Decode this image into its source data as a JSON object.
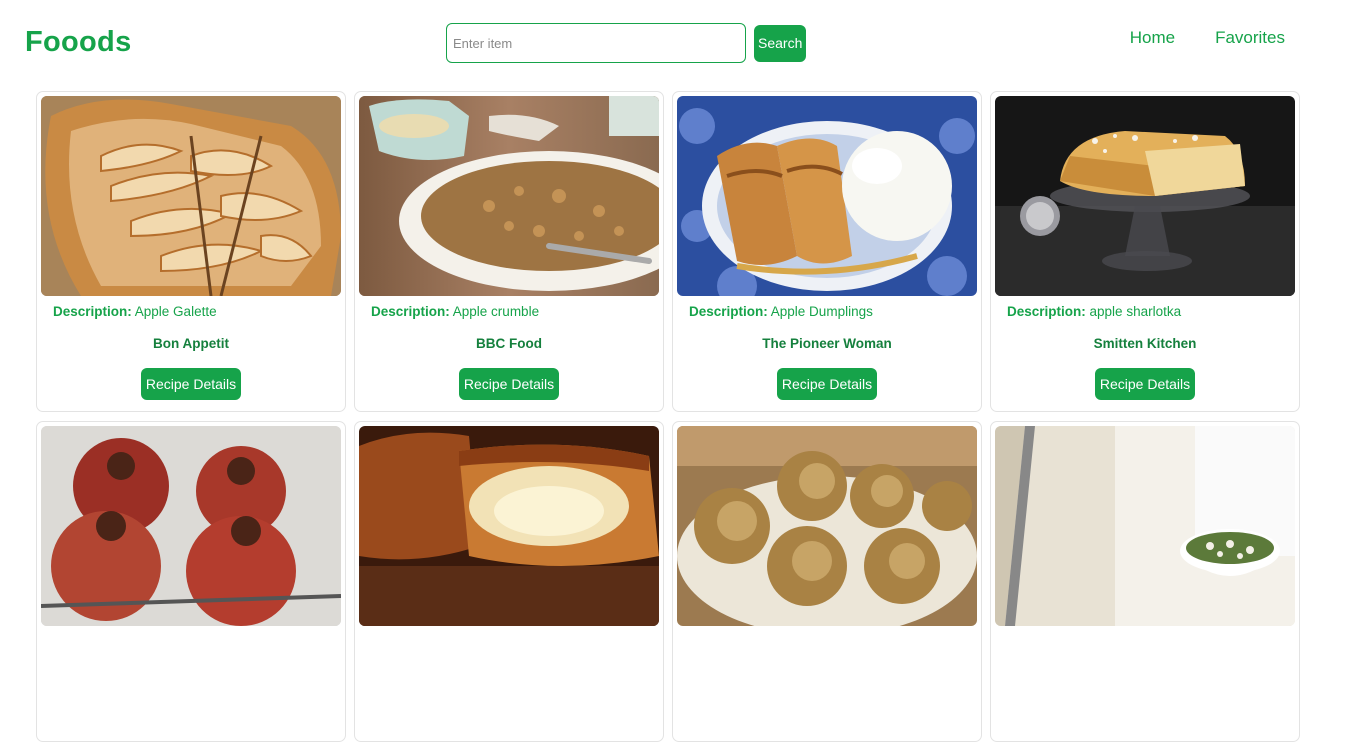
{
  "header": {
    "logo": "Fooods",
    "search": {
      "placeholder": "Enter item",
      "value": "",
      "button_label": "Search"
    },
    "nav": [
      {
        "label": "Home"
      },
      {
        "label": "Favorites"
      }
    ]
  },
  "recipes": [
    {
      "description_label": "Description:",
      "description": "Apple Galette",
      "source": "Bon Appetit",
      "button_label": "Recipe Details",
      "image": "apple-galette-photo"
    },
    {
      "description_label": "Description:",
      "description": "Apple crumble",
      "source": "BBC Food",
      "button_label": "Recipe Details",
      "image": "apple-crumble-photo"
    },
    {
      "description_label": "Description:",
      "description": "Apple Dumplings",
      "source": "The Pioneer Woman",
      "button_label": "Recipe Details",
      "image": "apple-dumplings-photo"
    },
    {
      "description_label": "Description:",
      "description": "apple sharlotka",
      "source": "Smitten Kitchen",
      "button_label": "Recipe Details",
      "image": "apple-sharlotka-photo"
    },
    {
      "image": "baked-apples-photo"
    },
    {
      "image": "apple-pastry-photo"
    },
    {
      "image": "apple-fritters-photo"
    },
    {
      "image": "salad-bowl-photo"
    }
  ],
  "colors": {
    "accent": "#16a34a",
    "accent_dark": "#15803d",
    "card_border": "#e3e3e3"
  }
}
